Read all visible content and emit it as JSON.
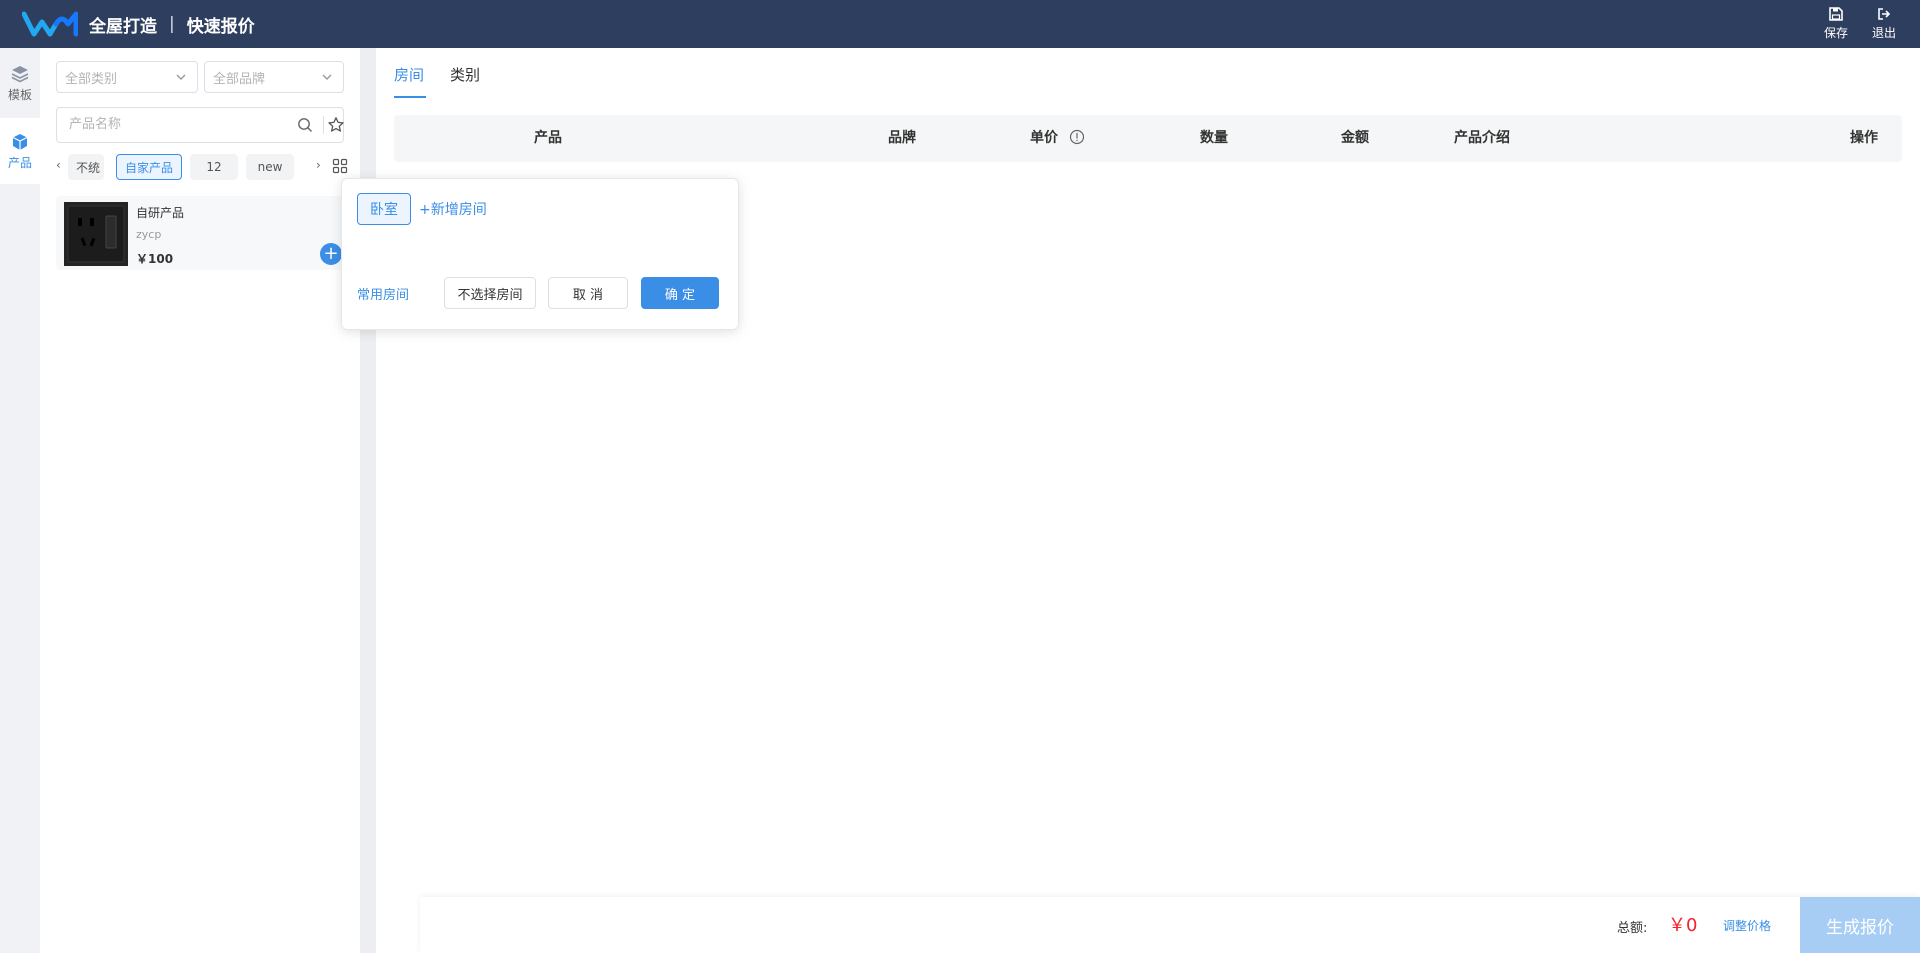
{
  "header": {
    "app_name": "全屋打造",
    "separator": "|",
    "page_name": "快速报价",
    "save_label": "保存",
    "exit_label": "退出",
    "bg_color": "#2e3e5e"
  },
  "rail": {
    "items": [
      {
        "label": "模板",
        "icon": "layers-icon"
      },
      {
        "label": "产品",
        "icon": "cube-icon",
        "active": true
      }
    ]
  },
  "filters": {
    "category_placeholder": "全部类别",
    "brand_placeholder": "全部品牌",
    "search_placeholder": "产品名称"
  },
  "tags": {
    "items": [
      "不统",
      "自家产品",
      "12",
      "new"
    ],
    "active": "自家产品"
  },
  "products": [
    {
      "name": "自研产品",
      "brand": "zycp",
      "price": "￥100"
    }
  ],
  "main": {
    "tabs": [
      {
        "label": "房间",
        "active": true
      },
      {
        "label": "类别",
        "active": false
      }
    ],
    "columns": {
      "product": "产品",
      "brand": "品牌",
      "unit_price": "单价",
      "quantity": "数量",
      "amount": "金额",
      "intro": "产品介绍",
      "actions": "操作"
    }
  },
  "footer": {
    "total_label": "总额:",
    "total_value": "￥0",
    "adjust_label": "调整价格",
    "generate_label": "生成报价"
  },
  "popover": {
    "room": "卧室",
    "add_room": "+新增房间",
    "common_rooms": "常用房间",
    "no_room": "不选择房间",
    "cancel": "取 消",
    "confirm": "确 定"
  },
  "colors": {
    "accent": "#3a8ee6",
    "price_red": "#f5222d"
  }
}
